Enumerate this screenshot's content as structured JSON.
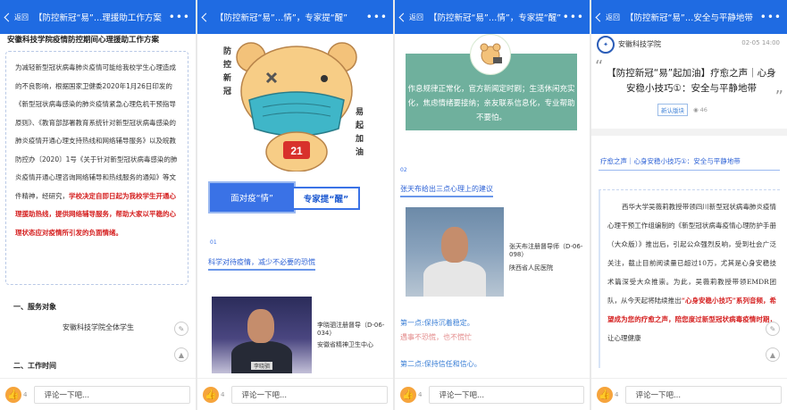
{
  "panels": [
    {
      "back": "返回",
      "title": "【防控新冠“易”…理援助工作方案",
      "heading": "安徽科技学院疫情防控期间心理援助工作方案",
      "body": "为减轻新型冠状病毒肺炎疫情可能给我校学生心理造成的不良影响，根据国家卫健委2020年1月26日印发的《新型冠状病毒感染的肺炎疫情紧急心理危机干预指导原则》、《教育部部署教育系统针对新型冠状病毒感染的肺炎疫情开通心理支持热线和网络辅导服务》以及皖教防控办〔2020〕1号《关于针对新型冠状病毒感染的肺炎疫情开通心理咨询网络辅导和热线服务的通知》等文件精神，经研究，",
      "body_red": "学校决定自即日起为我校学生开通心理援助热线，提供网络辅导服务，帮助大家以平稳的心理状态应对疫情所引发的负面情绪。",
      "section1": "一、服务对象",
      "section1_value": "安徽科技学院全体学生",
      "section2": "二、工作时间",
      "likes": "4",
      "comment_placeholder": "评论一下吧..."
    },
    {
      "back": "返回",
      "title": "【防控新冠“易”…情”，专家提“醒”",
      "vertical1": "防控新冠",
      "vertical2": "易起加油",
      "mask_number": "21",
      "banner_left": "面对疫“情”",
      "banner_right": "专家提“醒”",
      "num": "01",
      "subhead": "科学对待疫情，减少不必要的恐慌",
      "caption": "李晓驷注册督导（D-06-034）",
      "caption2": "安徽省精神卫生中心",
      "nameplate": "李晓驷",
      "likes": "4",
      "comment_placeholder": "评论一下吧..."
    },
    {
      "back": "返回",
      "title": "【防控新冠“易”…情”，专家提“醒”",
      "green_text": "作息规律正常化，官方新闻定时刷；生活休闲充实化，焦虑情绪要接纳；亲友联系信息化，专业帮助不要怕。",
      "num": "02",
      "subhead": "张天布给出三点心理上的建议",
      "caption": "张天布注册督导师（D-06-098）",
      "caption2": "陕西省人民医院",
      "point1": "第一点:保持沉着稳定。",
      "point1_sub": "遇事不恐慌，也不慌忙",
      "point2": "第二点:保持信任和信心。",
      "likes": "4",
      "comment_placeholder": "评论一下吧..."
    },
    {
      "back": "返回",
      "title": "【防控新冠“易”…安全与平静地带",
      "org": "安徽科技学院",
      "date": "02-05 14:00",
      "headline": "【防控新冠“易”起加油】疗愈之声｜心身安稳小技巧①：安全与平静地带",
      "tag": "新认版块",
      "views": "46",
      "subtitle": "疗愈之声｜心身安稳小技巧①：安全与平静地带",
      "body": "西华大学吴薇莉教授带领四川新型冠状病毒肺炎疫情心理干预工作组编制的《新型冠状病毒疫情心理防护手册（大众版）》推出后，引起公众强烈反响，受到社会广泛关注，截止目前阅读量已超过10万，尤其是心身安稳技术篇深受大众推崇。为此，吴薇莉教授带领EMDR团队，从今天起将陆续推出",
      "body_red": "“心身安稳小技巧”系列音频，希望成为您的疗愈之声，陪您度过新型冠状病毒疫情时期，",
      "body_tail": "让心理健康",
      "likes": "4",
      "comment_placeholder": "评论一下吧..."
    }
  ],
  "colors": {
    "topbar": "#1f6be2",
    "accent": "#3a72e6",
    "red": "#d51f1f",
    "green": "#6fb09d"
  }
}
